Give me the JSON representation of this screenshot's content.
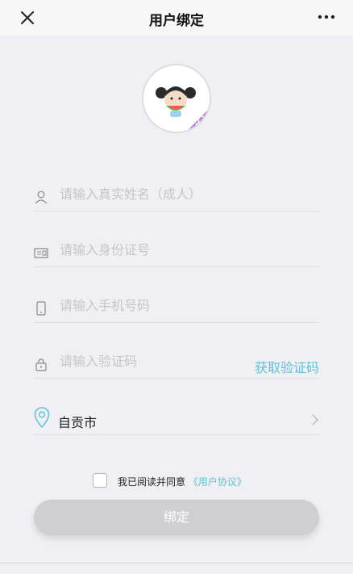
{
  "header": {
    "title": "用户绑定"
  },
  "form": {
    "name_placeholder": "请输入真实姓名（成人）",
    "id_placeholder": "请输入身份证号",
    "phone_placeholder": "请输入手机号码",
    "code_placeholder": "请输入验证码",
    "get_code_label": "获取验证码",
    "city": "自贡市"
  },
  "agreement": {
    "text": "我已阅读并同意",
    "link": "《用户协议》"
  },
  "bind_button": "绑定",
  "colors": {
    "accent": "#5fc2d3",
    "badge": "#b987d4",
    "button_disabled": "#cfcfd3"
  }
}
